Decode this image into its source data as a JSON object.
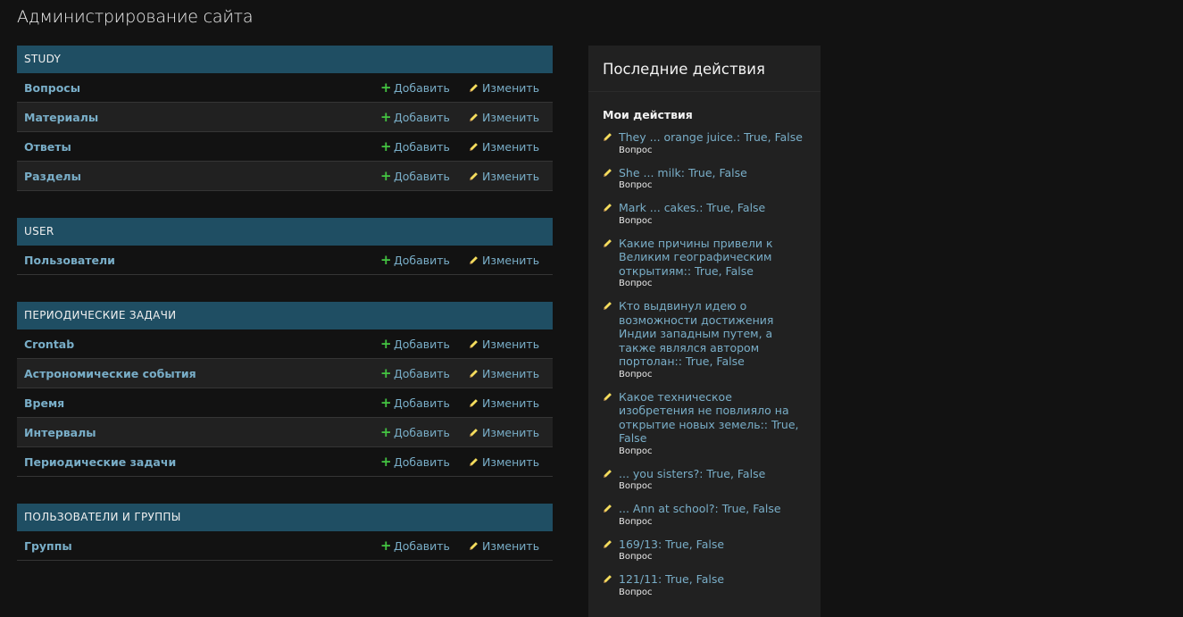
{
  "page": {
    "title": "Администрирование сайта"
  },
  "links": {
    "add": "Добавить",
    "change": "Изменить"
  },
  "colors": {
    "background": "#121212",
    "caption": "#1f4e63",
    "link": "#79aec8",
    "add_icon": "#44c542",
    "change_icon": "#f5dd5d",
    "panel": "#212121"
  },
  "modules": [
    {
      "caption": "STUDY",
      "models": [
        "Вопросы",
        "Материалы",
        "Ответы",
        "Разделы"
      ]
    },
    {
      "caption": "USER",
      "models": [
        "Пользователи"
      ]
    },
    {
      "caption": "ПЕРИОДИЧЕСКИЕ ЗАДАЧИ",
      "models": [
        "Crontab",
        "Астрономические события",
        "Время",
        "Интервалы",
        "Периодические задачи"
      ]
    },
    {
      "caption": "ПОЛЬЗОВАТЕЛИ И ГРУППЫ",
      "models": [
        "Группы"
      ]
    }
  ],
  "recent_actions": {
    "title": "Последние действия",
    "subtitle": "Мои действия",
    "items": [
      {
        "text": "They ... orange juice.: True, False",
        "type": "Вопрос"
      },
      {
        "text": "She ... milk: True, False",
        "type": "Вопрос"
      },
      {
        "text": "Mark ... cakes.: True, False",
        "type": "Вопрос"
      },
      {
        "text": "Какие причины привели к Великим географическим открытиям:: True, False",
        "type": "Вопрос"
      },
      {
        "text": "Кто выдвинул идею о возможности достижения Индии западным путем, а также являлся автором портолан:: True, False",
        "type": "Вопрос"
      },
      {
        "text": "Какое техническое изобретения не повлияло на открытие новых земель:: True, False",
        "type": "Вопрос"
      },
      {
        "text": "... you sisters?: True, False",
        "type": "Вопрос"
      },
      {
        "text": "... Ann at school?: True, False",
        "type": "Вопрос"
      },
      {
        "text": "169/13: True, False",
        "type": "Вопрос"
      },
      {
        "text": "121/11: True, False",
        "type": "Вопрос"
      }
    ]
  }
}
